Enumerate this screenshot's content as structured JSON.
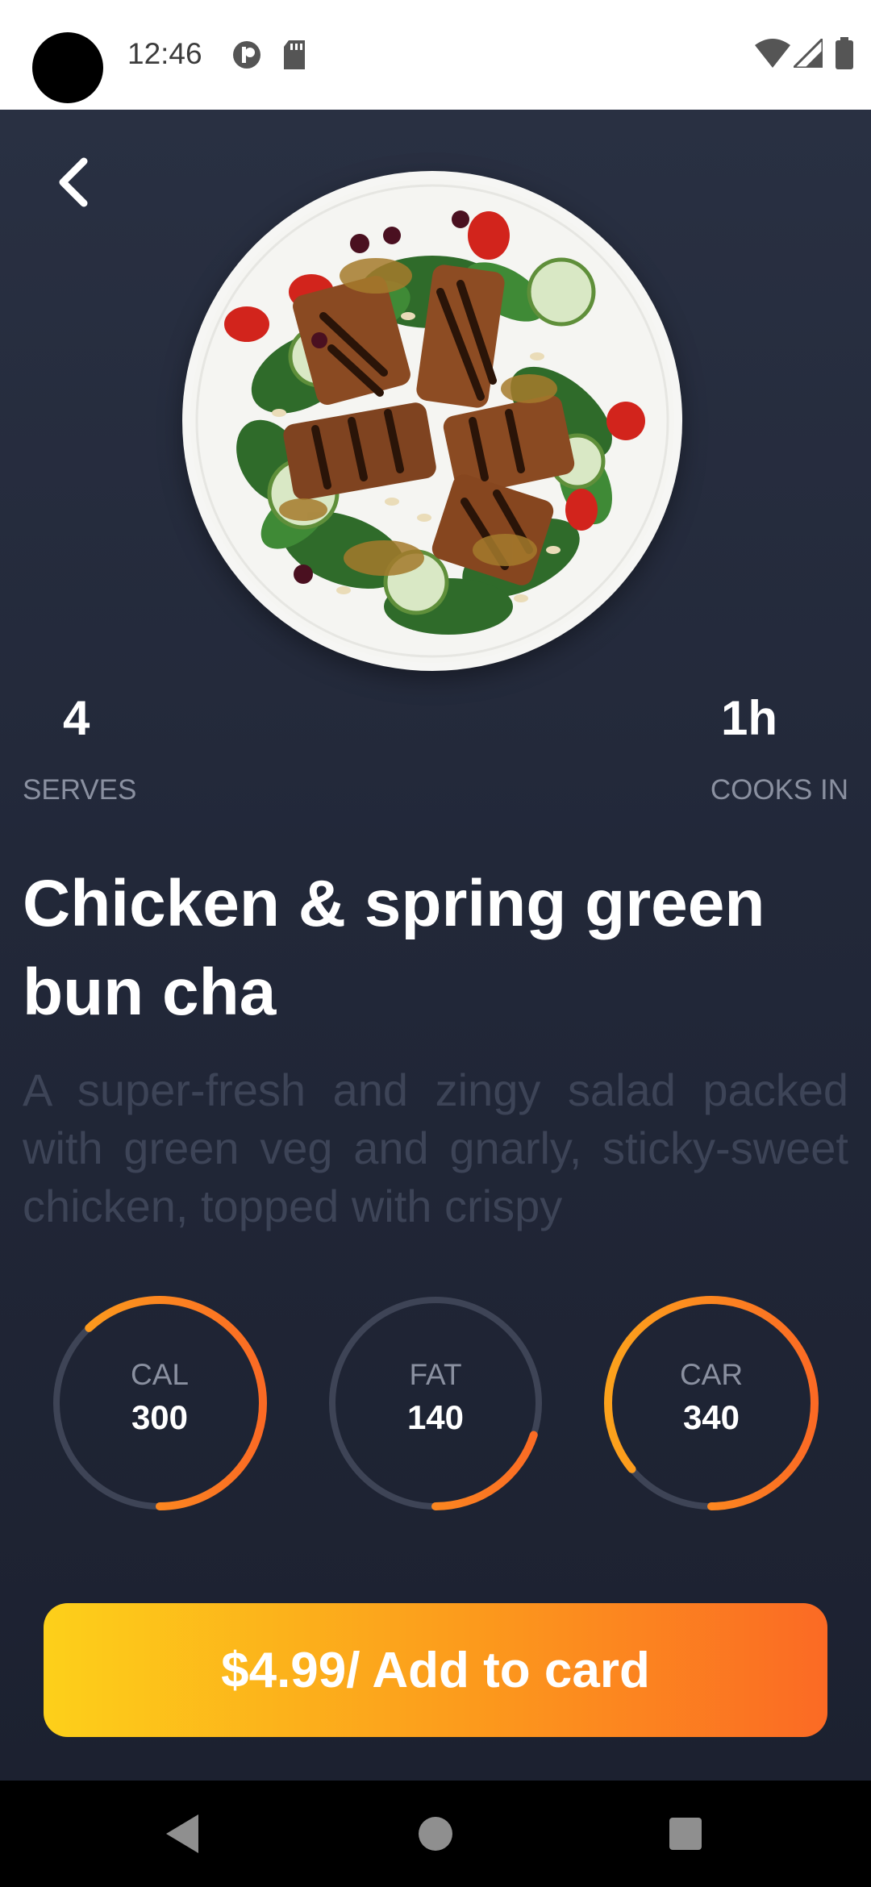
{
  "status_bar": {
    "time": "12:46"
  },
  "recipe": {
    "serves_value": "4",
    "serves_label": "SERVES",
    "cooks_value": "1h",
    "cooks_label": "COOKS IN",
    "title": "Chicken & spring green bun cha",
    "description": "A super-fresh and zingy salad packed with green veg and gnarly, sticky-sweet chicken, topped with crispy"
  },
  "nutrition": [
    {
      "label": "CAL",
      "value": "300",
      "progress": 0.62
    },
    {
      "label": "FAT",
      "value": "140",
      "progress": 0.2
    },
    {
      "label": "CAR",
      "value": "340",
      "progress": 0.86
    }
  ],
  "cta": {
    "label": "$4.99/ Add to card"
  },
  "colors": {
    "accent_start": "#fdd01a",
    "accent_end": "#fb6a24",
    "background": "#232939"
  },
  "icons": [
    "back-arrow-icon",
    "dish-image",
    "wifi-icon",
    "signal-icon",
    "battery-icon"
  ]
}
